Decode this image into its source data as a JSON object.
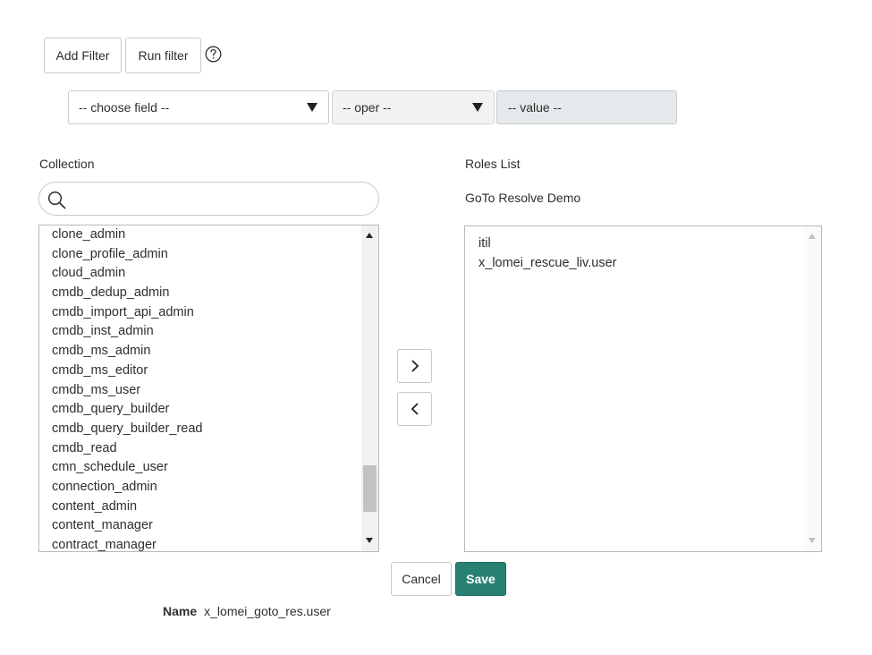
{
  "filter": {
    "add_label": "Add Filter",
    "run_label": "Run filter",
    "help_icon": "question-circle-icon",
    "field_select": "-- choose field --",
    "oper_select": "-- oper --",
    "value_field": "-- value --"
  },
  "collection": {
    "label": "Collection",
    "search_placeholder": "",
    "items": [
      "clone_admin",
      "clone_profile_admin",
      "cloud_admin",
      "cmdb_dedup_admin",
      "cmdb_import_api_admin",
      "cmdb_inst_admin",
      "cmdb_ms_admin",
      "cmdb_ms_editor",
      "cmdb_ms_user",
      "cmdb_query_builder",
      "cmdb_query_builder_read",
      "cmdb_read",
      "cmn_schedule_user",
      "connection_admin",
      "content_admin",
      "content_manager",
      "contract_manager"
    ]
  },
  "move": {
    "right_icon": "chevron-right-icon",
    "left_icon": "chevron-left-icon"
  },
  "roles": {
    "label": "Roles List",
    "group_name": "GoTo Resolve Demo",
    "items": [
      "itil",
      "x_lomei_rescue_liv.user"
    ]
  },
  "actions": {
    "cancel_label": "Cancel",
    "save_label": "Save"
  },
  "record": {
    "name_label": "Name",
    "name_value": "x_lomei_goto_res.user"
  },
  "colors": {
    "save_bg": "#278072",
    "disabled_field_bg": "#e6e9eb"
  }
}
